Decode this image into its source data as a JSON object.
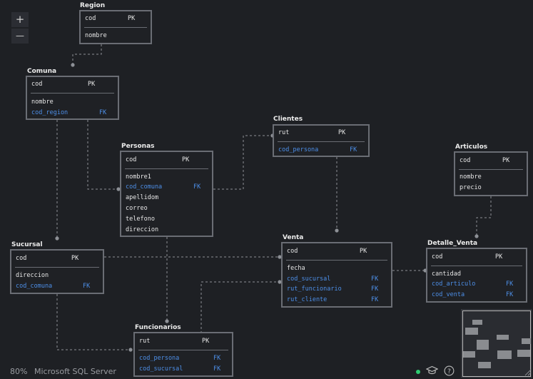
{
  "controls": {
    "zoom_in": "+",
    "zoom_out": "—"
  },
  "status": {
    "zoom": "80%",
    "dialect": "Microsoft SQL Server"
  },
  "tables": {
    "region": {
      "name": "Region",
      "pk_field": "cod",
      "pk": "PK",
      "fields": [
        "nombre"
      ]
    },
    "comuna": {
      "name": "Comuna",
      "pk_field": "cod",
      "pk": "PK",
      "fields": [
        "nombre"
      ],
      "fk_fields": [
        "cod_region"
      ],
      "fk": "FK"
    },
    "clientes": {
      "name": "Clientes",
      "pk_field": "rut",
      "pk": "PK",
      "fk_fields": [
        "cod_persona"
      ],
      "fk": "FK"
    },
    "personas": {
      "name": "Personas",
      "pk_field": "cod",
      "pk": "PK",
      "fields": [
        "nombre1",
        "apellidom",
        "correo",
        "telefono",
        "direccion"
      ],
      "fk_fields": [
        "cod_comuna"
      ],
      "fk": "FK"
    },
    "articulos": {
      "name": "Articulos",
      "pk_field": "cod",
      "pk": "PK",
      "fields": [
        "nombre",
        "precio"
      ]
    },
    "sucursal": {
      "name": "Sucursal",
      "pk_field": "cod",
      "pk": "PK",
      "fields": [
        "direccion"
      ],
      "fk_fields": [
        "cod_comuna"
      ],
      "fk": "FK"
    },
    "venta": {
      "name": "Venta",
      "pk_field": "cod",
      "pk": "PK",
      "fields": [
        "fecha"
      ],
      "fk_fields": [
        "cod_sucursal",
        "rut_funcionario",
        "rut_cliente"
      ],
      "fk": "FK"
    },
    "detalle": {
      "name": "Detalle_Venta",
      "pk_field": "cod",
      "pk": "PK",
      "fields": [
        "cantidad"
      ],
      "fk_fields": [
        "cod_articulo",
        "cod_venta"
      ],
      "fk": "FK"
    },
    "funcionarios": {
      "name": "Funcionarios",
      "pk_field": "rut",
      "pk": "PK",
      "fk_fields": [
        "cod_persona",
        "cod_sucursal"
      ],
      "fk": "FK"
    }
  },
  "colors": {
    "background": "#1e2024",
    "border": "#6a6d74",
    "fk_text": "#4d8fe8",
    "status_dot": "#2ecc71"
  },
  "icons": [
    "graduation-cap-icon",
    "help-icon",
    "resize-corner-icon"
  ]
}
